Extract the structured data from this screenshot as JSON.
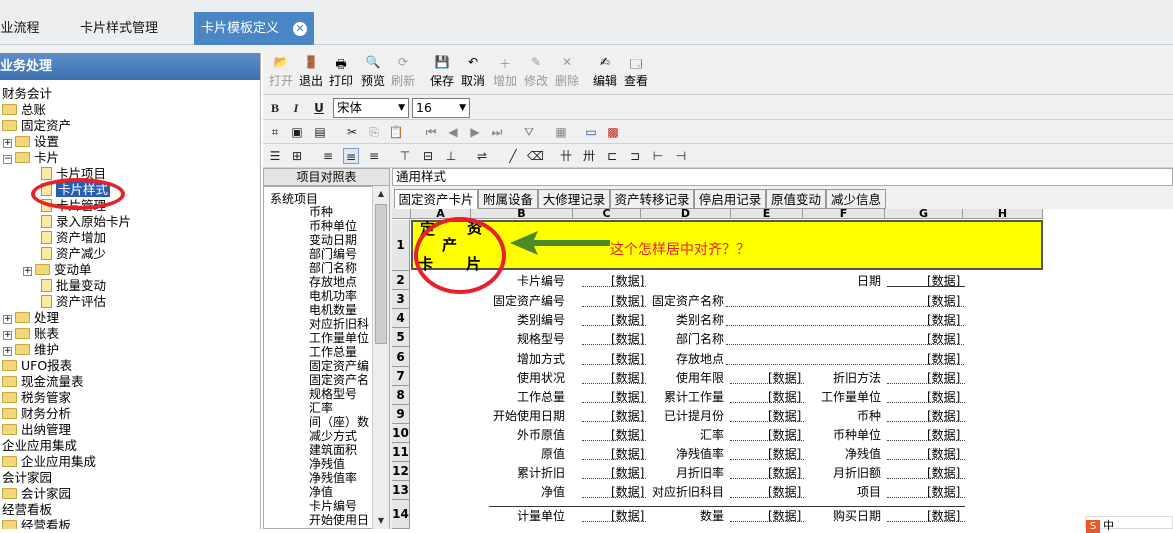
{
  "tabs": {
    "t1": "业流程",
    "t2": "卡片样式管理",
    "t3": "卡片模板定义"
  },
  "left": {
    "header": "业务处理",
    "items": [
      "财务会计",
      "总账",
      "固定资产",
      "设置",
      "卡片",
      "卡片项目",
      "卡片样式",
      "卡片管理",
      "录入原始卡片",
      "资产增加",
      "资产减少",
      "变动单",
      "批量变动",
      "资产评估",
      "处理",
      "账表",
      "维护",
      "UFO报表",
      "现金流量表",
      "税务管家",
      "财务分析",
      "出纳管理",
      "企业应用集成",
      "企业应用集成",
      "会计家园",
      "会计家园",
      "经营看板",
      "经营看板"
    ]
  },
  "toolbar": {
    "open": "打开",
    "exit": "退出",
    "print": "打印",
    "preview": "预览",
    "refresh": "刷新",
    "save": "保存",
    "cancel": "取消",
    "add": "增加",
    "modify": "修改",
    "delete": "删除",
    "edit": "编辑",
    "view": "查看",
    "font_name": "宋体",
    "font_size": "16",
    "bold": "B",
    "italic": "I",
    "underline": "U"
  },
  "mid": {
    "header": "项目对照表",
    "root": "系统项目",
    "items": [
      "币种",
      "币种单位",
      "变动日期",
      "部门编号",
      "部门名称",
      "存放地点",
      "电机功率",
      "电机数量",
      "对应折旧科",
      "工作量单位",
      "工作总量",
      "固定资产编",
      "固定资产名",
      "规格型号",
      "汇率",
      "间（座）数",
      "减少方式",
      "建筑面积",
      "净残值",
      "净残值率",
      "净值",
      "卡片编号",
      "开始使用日"
    ]
  },
  "style_name": "通用样式",
  "card_tabs": [
    "固定资产卡片",
    "附属设备",
    "大修理记录",
    "资产转移记录",
    "停启用记录",
    "原值变动",
    "减少信息"
  ],
  "sheet": {
    "cols": [
      "A",
      "B",
      "C",
      "D",
      "E",
      "F",
      "G",
      "H"
    ],
    "rows": [
      "1",
      "2",
      "3",
      "4",
      "5",
      "6",
      "7",
      "8",
      "9",
      "10",
      "11",
      "12",
      "13",
      "14"
    ],
    "title_chars": [
      "定",
      "资",
      "产",
      "卡",
      "片"
    ],
    "annotation": "这个怎样居中对齐？？",
    "placeholder": "[数据]",
    "r2": {
      "l1": "卡片编号",
      "l3": "日期"
    },
    "r3": {
      "l1": "固定资产编号",
      "l2": "固定资产名称"
    },
    "r4": {
      "l1": "类别编号",
      "l2": "类别名称"
    },
    "r5": {
      "l1": "规格型号",
      "l2": "部门名称"
    },
    "r6": {
      "l1": "增加方式",
      "l2": "存放地点"
    },
    "r7": {
      "l1": "使用状况",
      "l2": "使用年限",
      "l3": "折旧方法"
    },
    "r8": {
      "l1": "工作总量",
      "l2": "累计工作量",
      "l3": "工作量单位"
    },
    "r9": {
      "l1": "开始使用日期",
      "l2": "已计提月份",
      "l3": "币种"
    },
    "r10": {
      "l1": "外币原值",
      "l2": "汇率",
      "l3": "币种单位"
    },
    "r11": {
      "l1": "原值",
      "l2": "净残值率",
      "l3": "净残值"
    },
    "r12": {
      "l1": "累计折旧",
      "l2": "月折旧率",
      "l3": "月折旧额"
    },
    "r13": {
      "l1": "净值",
      "l2": "对应折旧科目",
      "l3": "项目"
    },
    "r14": {
      "l1": "计量单位",
      "l2": "数量",
      "l3": "购买日期"
    }
  },
  "corner_text": "中"
}
